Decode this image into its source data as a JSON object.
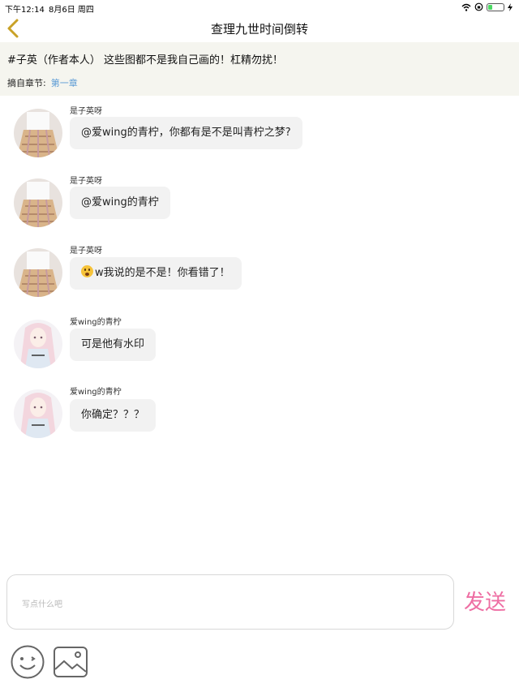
{
  "status_bar": {
    "time": "下午12:14",
    "date": "8月6日 周四"
  },
  "nav": {
    "title": "查理九世时间倒转",
    "back_icon": "chevron-left-icon"
  },
  "excerpt": {
    "text": "#子英（作者本人） 这些图都不是我自己画的！杠精勿扰！",
    "chapter_prefix": "摘自章节:",
    "chapter_link": "第一章"
  },
  "messages": [
    {
      "sender": "是子英呀",
      "text": "@爱wing的青柠，你都有是不是叫青柠之梦?",
      "emoji": "",
      "avatar": "plaid-skirt"
    },
    {
      "sender": "是子英呀",
      "text": "@爱wing的青柠",
      "emoji": "",
      "avatar": "plaid-skirt"
    },
    {
      "sender": "是子英呀",
      "text": "w我说的是不是！你看错了！",
      "emoji": "surprised-face-emoji",
      "avatar": "plaid-skirt"
    },
    {
      "sender": "爱wing的青柠",
      "text": "可是他有水印",
      "emoji": "",
      "avatar": "anime-girl"
    },
    {
      "sender": "爱wing的青柠",
      "text": "你确定？？？",
      "emoji": "",
      "avatar": "anime-girl"
    }
  ],
  "composer": {
    "placeholder": "写点什么吧",
    "send_label": "发送"
  },
  "colors": {
    "accent_pink": "#ee6ea3",
    "link_blue": "#5b9bd5",
    "back_gold": "#c9a227",
    "header_bg": "#f5f5ef",
    "bubble_bg": "#f2f2f2"
  }
}
